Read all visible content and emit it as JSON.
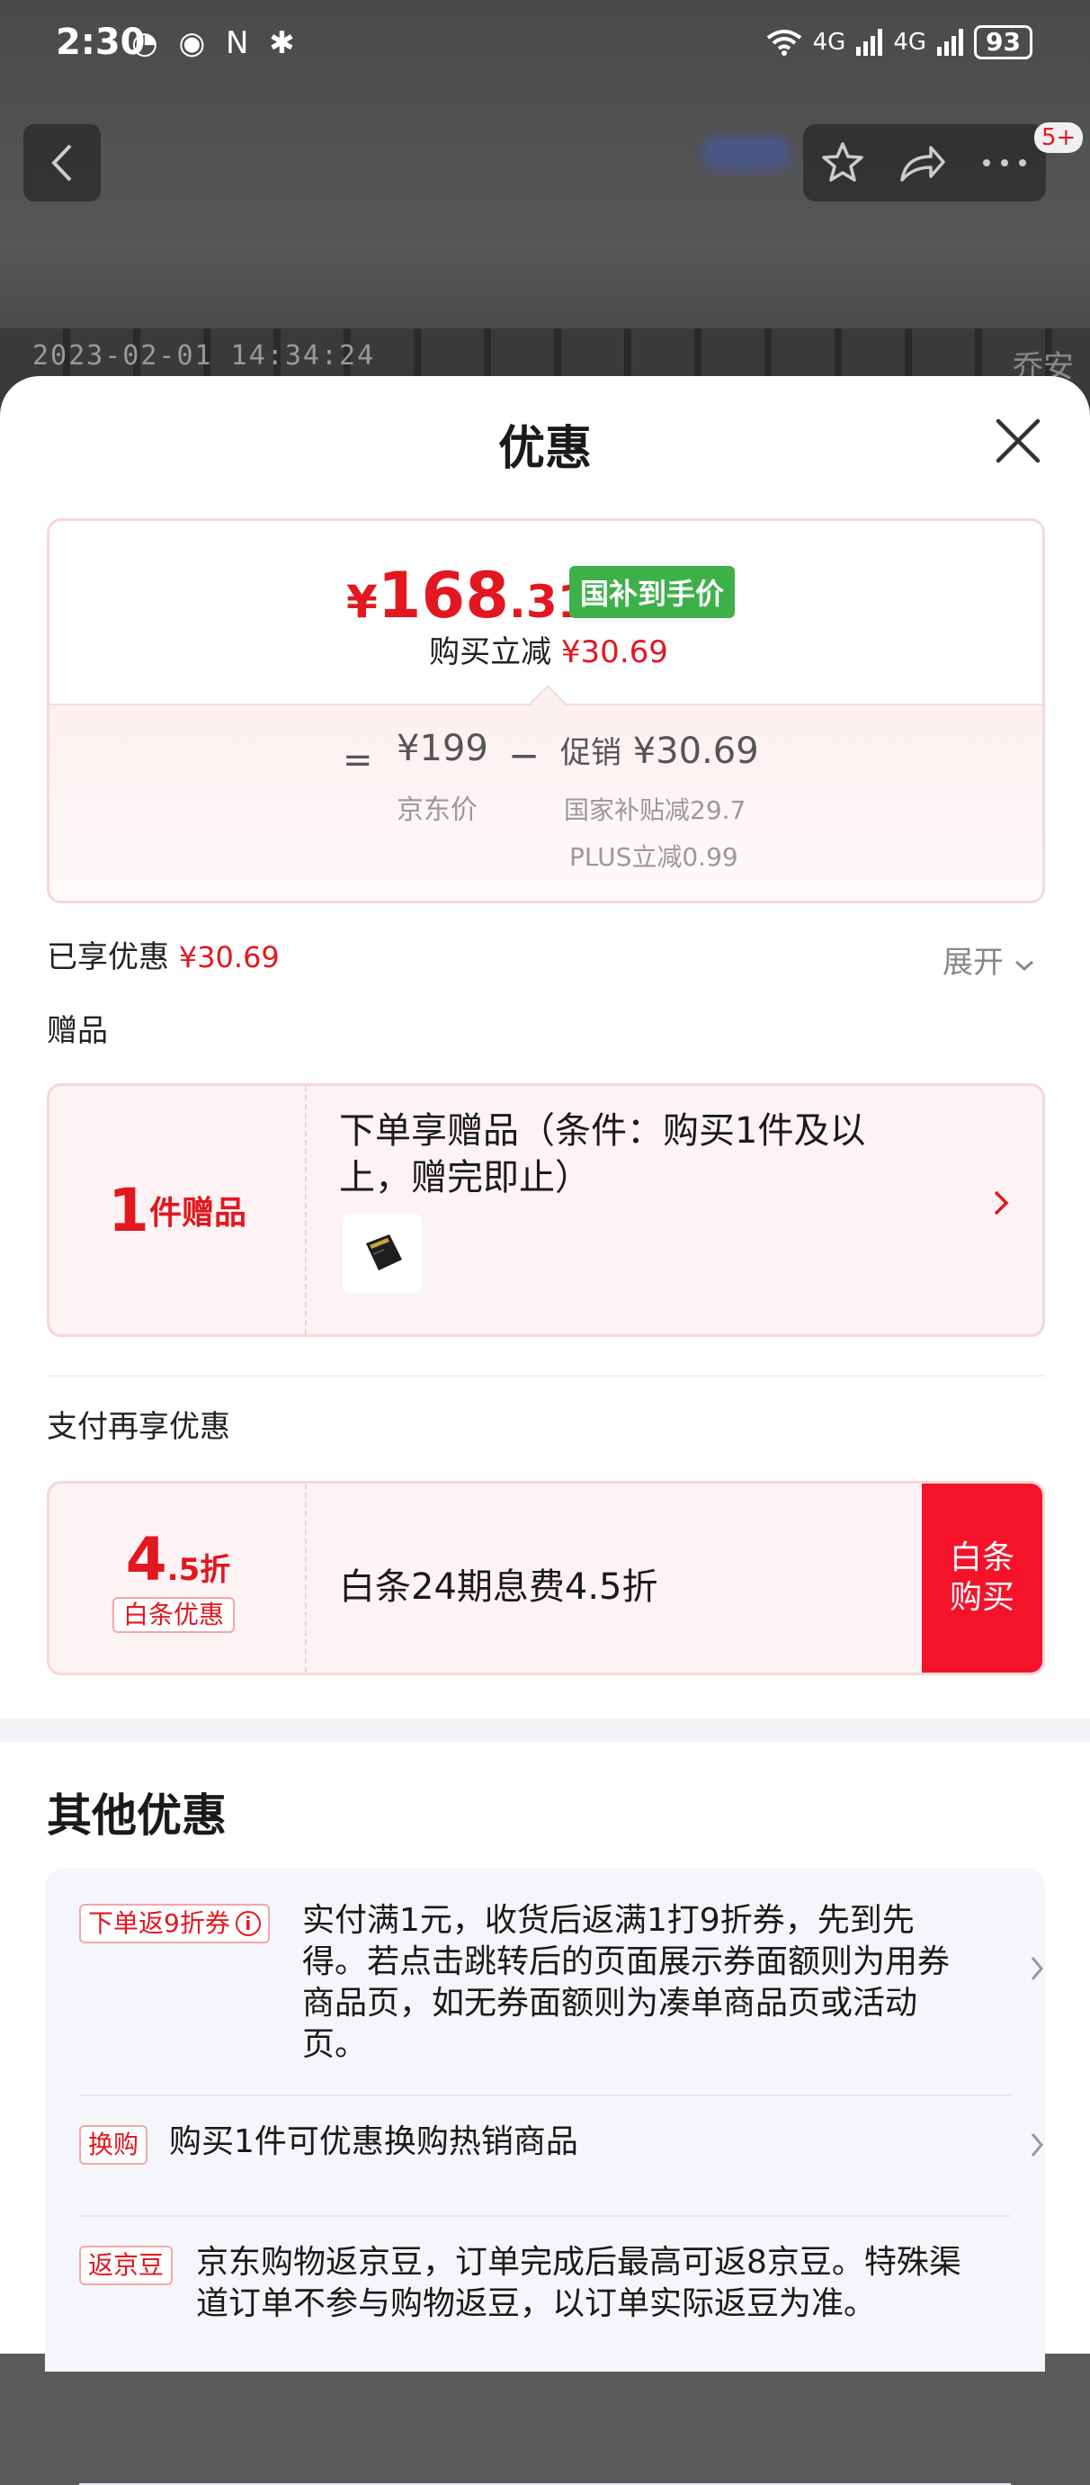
{
  "status_bar": {
    "time": "2:30",
    "left_icons": "◔ ◉ N ✱",
    "network_1": "4G",
    "network_2": "4G",
    "battery": "93"
  },
  "background_page": {
    "timestamp": "2023-02-01  14:34:24",
    "watermark": "乔安",
    "badge": "5+"
  },
  "sheet": {
    "title": "优惠",
    "final_price": {
      "symbol": "¥",
      "integer": "168",
      "decimal": ".31",
      "tag": "国补到手价"
    },
    "instant_cut": {
      "label": "购买立减",
      "value": "¥30.69"
    },
    "formula": {
      "equals": "=",
      "jd_price": "¥199",
      "jd_price_label": "京东价",
      "minus": "−",
      "promo_label": "促销",
      "promo_value": "¥30.69",
      "sub_items": [
        "国家补贴减29.7",
        "PLUS立减0.99"
      ]
    },
    "enjoyed": {
      "label": "已享优惠",
      "value": "¥30.69"
    },
    "expand_label": "展开",
    "gift": {
      "heading": "赠品",
      "count": "1",
      "count_unit": "件赠品",
      "description": "下单享赠品（条件：购买1件及以上，赠完即止）"
    },
    "payment": {
      "heading": "支付再享优惠",
      "discount_int": "4",
      "discount_rest": ".5折",
      "tag": "白条优惠",
      "description": "白条24期息费4.5折",
      "buy_line1": "白条",
      "buy_line2": "购买"
    },
    "other": {
      "heading": "其他优惠",
      "items": [
        {
          "tag": "下单返9折券",
          "text": "实付满1元，收货后返满1打9折券，先到先得。若点击跳转后的页面展示券面额则为用券商品页，如无券面额则为凑单商品页或活动页。"
        },
        {
          "tag": "换购",
          "text": "购买1件可优惠换购热销商品"
        },
        {
          "tag": "返京豆",
          "text": "京东购物返京豆，订单完成后最高可返8京豆。特殊渠道订单不参与购物返豆，以订单实际返豆为准。"
        }
      ]
    }
  },
  "colors": {
    "accent_red": "#e3171f",
    "buy_red": "#f5132a",
    "subsidy_green": "#3db04a"
  },
  "icons": {
    "back": "chevron-left-icon",
    "favorite": "star-icon",
    "share": "share-icon",
    "more": "more-dots-icon",
    "close": "close-icon",
    "expand": "chevron-down-icon",
    "row": "chevron-right-icon",
    "info": "info-icon",
    "gift_thumbnail": "memory-card-icon"
  }
}
